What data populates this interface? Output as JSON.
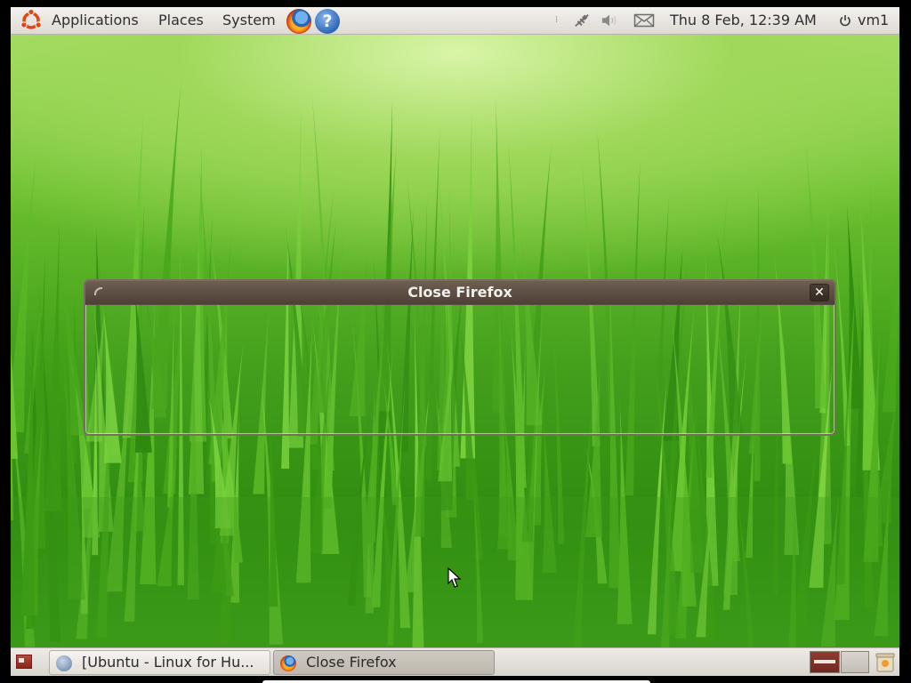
{
  "top_panel": {
    "menus": [
      {
        "label": "Applications"
      },
      {
        "label": "Places"
      },
      {
        "label": "System"
      }
    ],
    "launchers": [
      {
        "icon": "firefox-icon"
      },
      {
        "icon": "help-icon",
        "glyph": "?"
      }
    ],
    "tray": {
      "icons": [
        "network-icon",
        "volume-icon",
        "mail-icon"
      ],
      "clock": "Thu  8 Feb, 12:39 AM",
      "user": "vm1"
    }
  },
  "window": {
    "title": "Close Firefox",
    "close_glyph": "✕"
  },
  "bottom_panel": {
    "tasks": [
      {
        "label": "[Ubuntu - Linux for Hu...",
        "icon": "help-icon",
        "active": false
      },
      {
        "label": "Close Firefox",
        "icon": "firefox-icon",
        "active": true
      }
    ],
    "workspaces": 2
  },
  "colors": {
    "titlebar": "#574a3f",
    "panel": "#e6e3df",
    "wallpaper_green": "#3f9a18"
  }
}
